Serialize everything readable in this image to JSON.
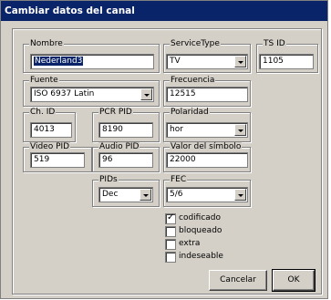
{
  "window": {
    "title": "Cambiar datos del canal"
  },
  "fields": {
    "nombre": {
      "label": "Nombre",
      "value": "Nederland3"
    },
    "service_type": {
      "label": "ServiceType",
      "value": "TV"
    },
    "ts_id": {
      "label": "TS ID",
      "value": "1105"
    },
    "fuente": {
      "label": "Fuente",
      "value": "ISO 6937 Latin"
    },
    "frecuencia": {
      "label": "Frecuencia",
      "value": "12515"
    },
    "ch_id": {
      "label": "Ch. ID",
      "value": "4013"
    },
    "pcr_pid": {
      "label": "PCR PID",
      "value": "8190"
    },
    "polaridad": {
      "label": "Polaridad",
      "value": "hor"
    },
    "video_pid": {
      "label": "Video PID",
      "value": "519"
    },
    "audio_pid": {
      "label": "Audio PID",
      "value": "96"
    },
    "valor_simbolo": {
      "label": "Valor del símbolo",
      "value": "22000"
    },
    "pids": {
      "label": "PIDs",
      "value": "Dec"
    },
    "fec": {
      "label": "FEC",
      "value": "5/6"
    }
  },
  "checkboxes": [
    {
      "label": "codificado",
      "checked": true
    },
    {
      "label": "bloqueado",
      "checked": false
    },
    {
      "label": "extra",
      "checked": false
    },
    {
      "label": "indeseable",
      "checked": false
    }
  ],
  "buttons": {
    "cancel": "Cancelar",
    "ok": "OK"
  }
}
